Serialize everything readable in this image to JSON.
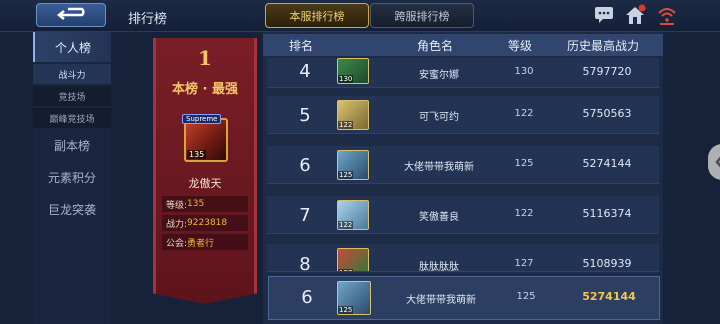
{
  "header": {
    "title": "排行榜",
    "tabs": [
      {
        "label": "本服排行榜",
        "active": true
      },
      {
        "label": "跨服排行榜",
        "active": false
      }
    ],
    "icons": [
      "back-arrow-icon",
      "chat-icon",
      "home-icon",
      "wifi-icon"
    ]
  },
  "sidebar": {
    "items": [
      {
        "label": "个人榜",
        "active": true
      },
      {
        "label": "战斗力",
        "sub": true,
        "active": true
      },
      {
        "label": "竞技场",
        "sub": true
      },
      {
        "label": "巅峰竞技场",
        "sub": true
      },
      {
        "label": "副本榜"
      },
      {
        "label": "元素积分"
      },
      {
        "label": "巨龙突袭"
      }
    ]
  },
  "banner": {
    "rank": "1",
    "title": "本榜 · 最强",
    "badge": "Supreme",
    "avatar_level": "135",
    "name": "龙傲天",
    "level_label": "等级:",
    "level_value": "135",
    "power_label": "战力:",
    "power_value": "9223818",
    "guild_label": "公会:",
    "guild_value": "勇者行"
  },
  "table": {
    "headers": {
      "rank": "排名",
      "name": "角色名",
      "level": "等级",
      "power": "历史最高战力"
    },
    "rows": [
      {
        "rank": "4",
        "hero_level": "130",
        "name": "安蜜尔娜",
        "level": "130",
        "power": "5797720"
      },
      {
        "rank": "5",
        "hero_level": "122",
        "name": "可飞可约",
        "level": "122",
        "power": "5750563"
      },
      {
        "rank": "6",
        "hero_level": "125",
        "name": "大佬带带我萌新",
        "level": "125",
        "power": "5274144"
      },
      {
        "rank": "7",
        "hero_level": "122",
        "name": "笑傲善良",
        "level": "122",
        "power": "5116374"
      },
      {
        "rank": "8",
        "hero_level": "127",
        "name": "肽肽肽肽",
        "level": "127",
        "power": "5108939"
      }
    ]
  },
  "my_rank": {
    "rank": "6",
    "hero_level": "125",
    "name": "大佬带带我萌新",
    "level": "125",
    "power": "5274144"
  },
  "colors": {
    "gold": "#f3c766",
    "banner_red": "#7a1e26",
    "highlight_power": "#f5c842"
  }
}
